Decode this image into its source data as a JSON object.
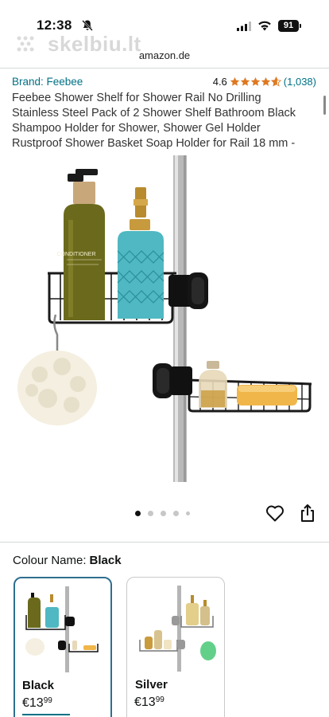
{
  "status": {
    "time": "12:38",
    "battery": "91"
  },
  "watermark": "skelbiu.lt",
  "browser": {
    "url": "amazon.de"
  },
  "product": {
    "brand": "Brand: Feebee",
    "rating": "4.6",
    "rating_stars": 4.6,
    "rating_count": "(1,038)",
    "title": "Feebee Shower Shelf for Shower Rail No Drilling Stainless Steel Pack of 2 Shower Shelf Bathroom Black Shampoo Holder for Shower, Shower Gel Holder Rustproof Shower Basket Soap Holder for Rail 18 mm -",
    "image_labels": {
      "bottle_label": "CONDITIONER"
    }
  },
  "gallery": {
    "dot_count": 5,
    "active_index": 0
  },
  "colour": {
    "label": "Colour Name:",
    "selected": "Black",
    "options": [
      {
        "name": "Black",
        "price_main": "€13",
        "price_cents": "99"
      },
      {
        "name": "Silver",
        "price_main": "€13",
        "price_cents": "99"
      }
    ]
  },
  "colors": {
    "link": "#007185",
    "star": "#de7921",
    "selected_border": "#2e6f8f"
  }
}
